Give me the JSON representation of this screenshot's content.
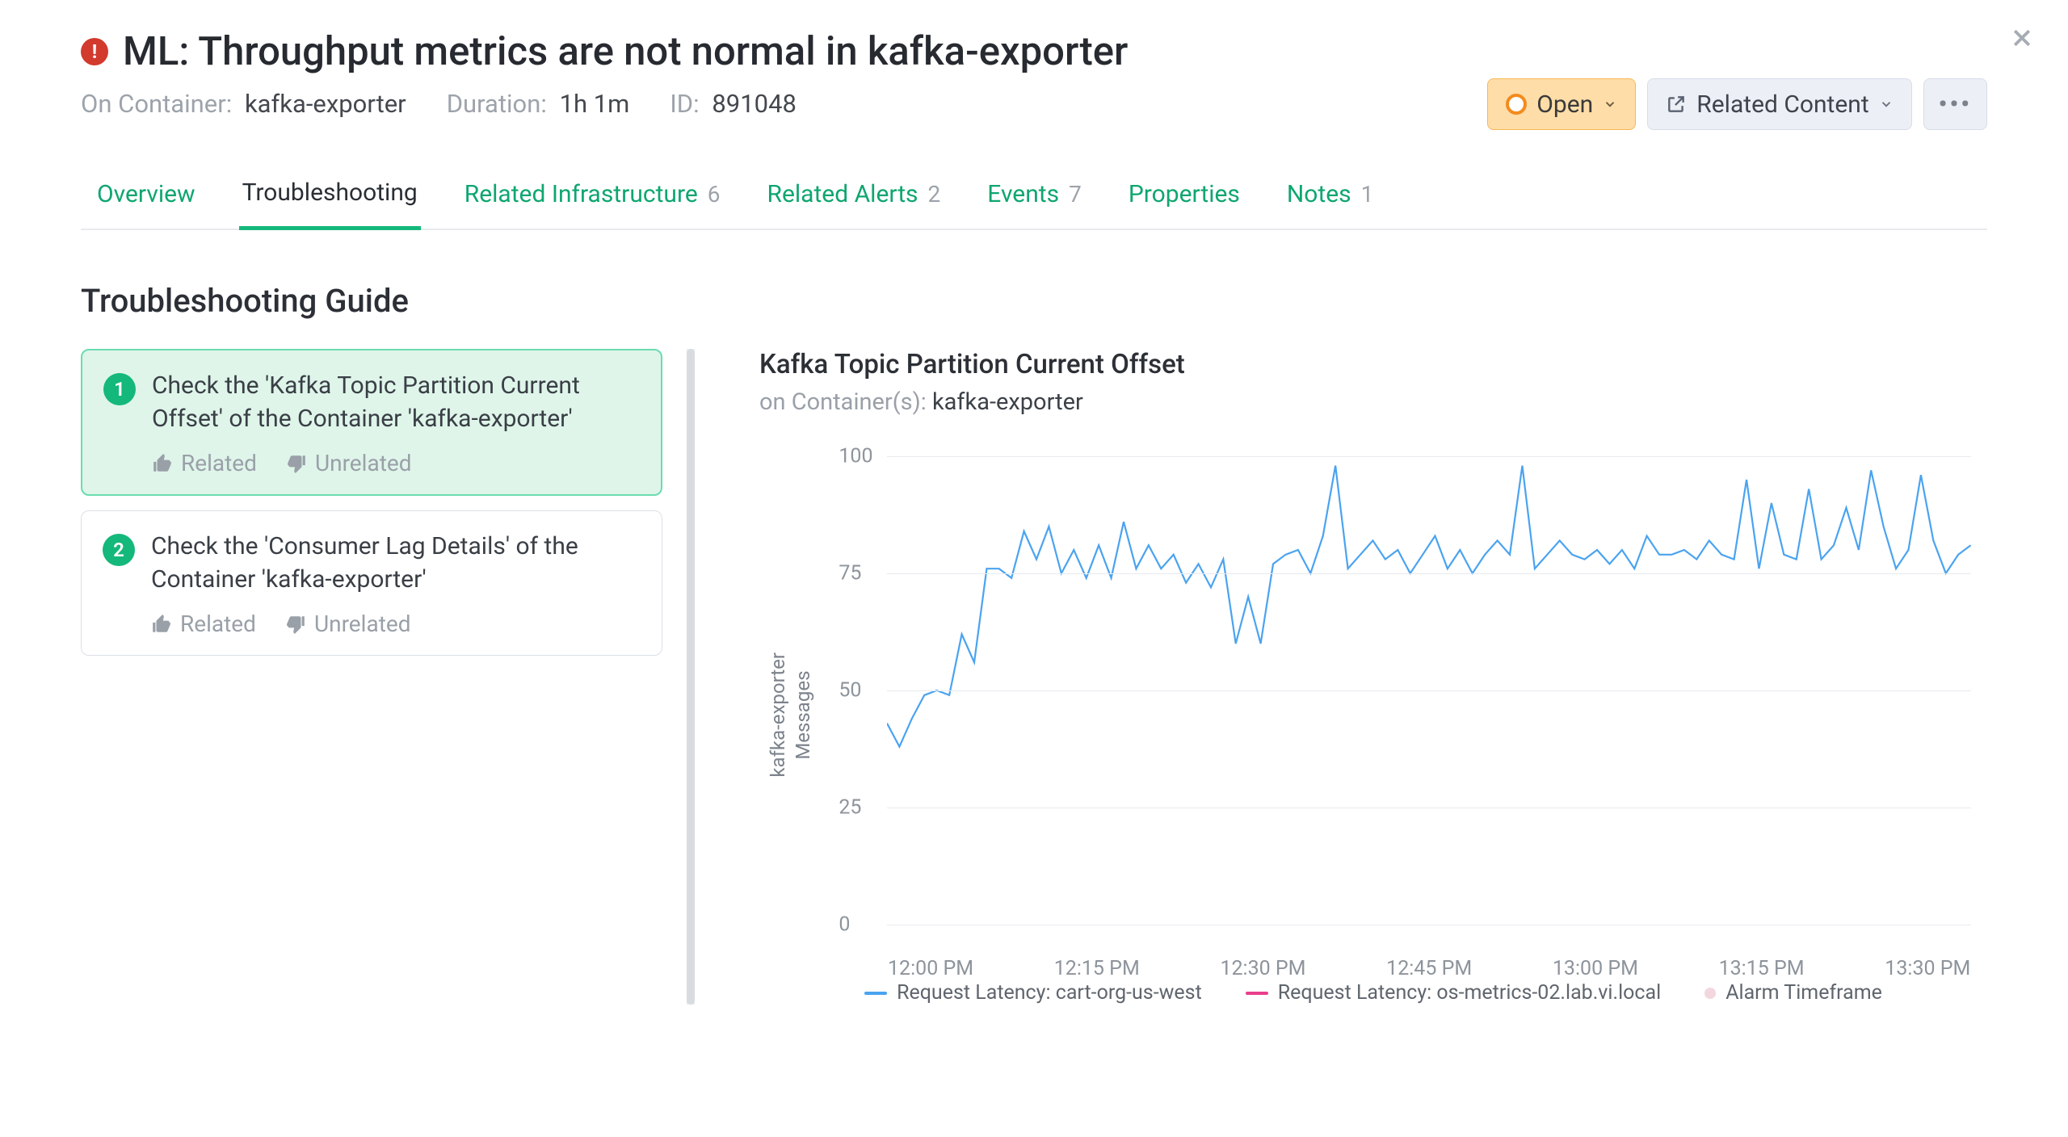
{
  "header": {
    "title": "ML: Throughput metrics are not normal in kafka-exporter",
    "container_label": "On Container:",
    "container_value": "kafka-exporter",
    "duration_label": "Duration:",
    "duration_value": "1h 1m",
    "id_label": "ID:",
    "id_value": "891048"
  },
  "actions": {
    "open_label": "Open",
    "related_label": "Related Content",
    "more_label": "•••"
  },
  "tabs": [
    {
      "label": "Overview"
    },
    {
      "label": "Troubleshooting"
    },
    {
      "label": "Related Infrastructure",
      "count": "6"
    },
    {
      "label": "Related Alerts",
      "count": "2"
    },
    {
      "label": "Events",
      "count": "7"
    },
    {
      "label": "Properties"
    },
    {
      "label": "Notes",
      "count": "1"
    }
  ],
  "section_title": "Troubleshooting Guide",
  "guide_items": [
    {
      "num": "1",
      "text": "Check the 'Kafka Topic Partition Current Offset' of the Container 'kafka-exporter'"
    },
    {
      "num": "2",
      "text": "Check the 'Consumer Lag Details' of the Container 'kafka-exporter'"
    }
  ],
  "feedback": {
    "related": "Related",
    "unrelated": "Unrelated"
  },
  "panel": {
    "title": "Kafka Topic Partition Current Offset",
    "sub_label": "on Container(s):",
    "sub_value": "kafka-exporter"
  },
  "chart_data": {
    "type": "line",
    "title": "Kafka Topic Partition Current Offset",
    "ylabel_line1": "kafka-exporter",
    "ylabel_line2": "Messages",
    "xlabel": "",
    "ylim": [
      0,
      100
    ],
    "y_ticks": [
      0,
      25,
      50,
      75,
      100
    ],
    "x_ticks": [
      "12:00 PM",
      "12:15 PM",
      "12:30 PM",
      "12:45 PM",
      "13:00 PM",
      "13:15 PM",
      "13:30 PM"
    ],
    "series": [
      {
        "name": "Request Latency: cart-org-us-west",
        "color": "#4aa3f0",
        "values": [
          43,
          38,
          44,
          49,
          50,
          49,
          62,
          56,
          76,
          76,
          74,
          84,
          78,
          85,
          75,
          80,
          74,
          81,
          74,
          86,
          76,
          81,
          76,
          79,
          73,
          77,
          72,
          78,
          60,
          70,
          60,
          77,
          79,
          80,
          75,
          83,
          98,
          76,
          79,
          82,
          78,
          80,
          75,
          79,
          83,
          76,
          80,
          75,
          79,
          82,
          79,
          98,
          76,
          79,
          82,
          79,
          78,
          80,
          77,
          80,
          76,
          83,
          79,
          79,
          80,
          78,
          82,
          79,
          78,
          95,
          76,
          90,
          79,
          78,
          93,
          78,
          81,
          89,
          80,
          97,
          85,
          76,
          80,
          96,
          82,
          75,
          79,
          81
        ]
      },
      {
        "name": "Request Latency: os-metrics-02.lab.vi.local",
        "color": "#e83e8c",
        "values": []
      }
    ],
    "legend": [
      {
        "label": "Request Latency: cart-org-us-west",
        "kind": "line",
        "color": "#4aa3f0"
      },
      {
        "label": "Request Latency: os-metrics-02.lab.vi.local",
        "kind": "line",
        "color": "#e83e8c"
      },
      {
        "label": "Alarm Timeframe",
        "kind": "dot",
        "color": "#f3d7df"
      }
    ]
  }
}
